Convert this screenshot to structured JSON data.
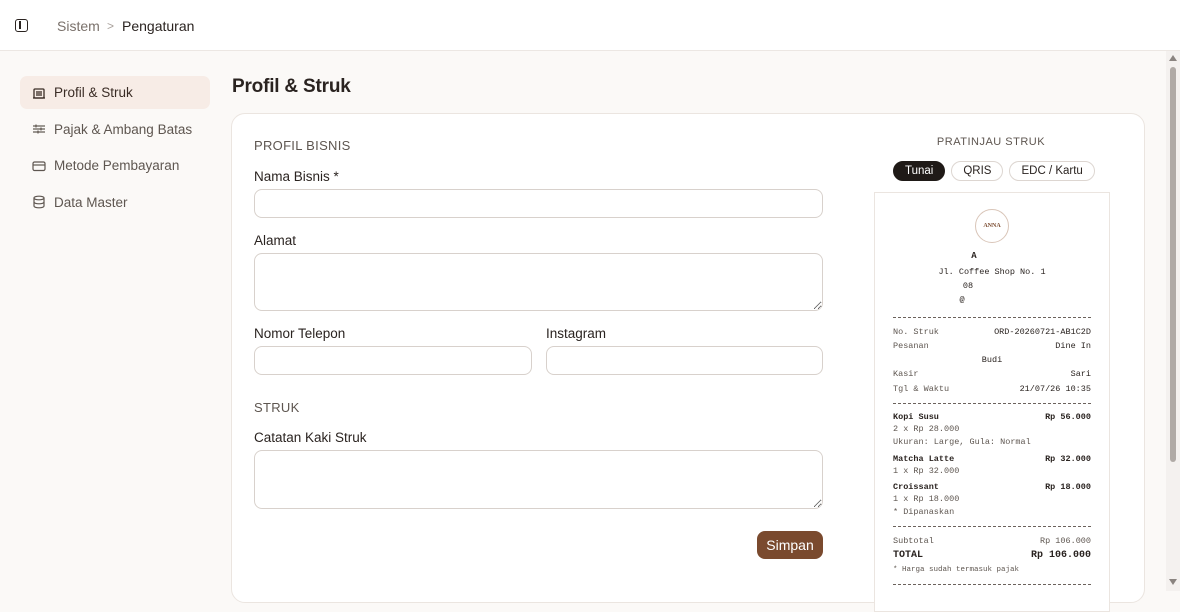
{
  "breadcrumb": {
    "parent": "Sistem",
    "separator": ">",
    "current": "Pengaturan"
  },
  "sidebar": {
    "items": [
      {
        "label": "Profil & Struk",
        "icon": "building-icon",
        "active": true
      },
      {
        "label": "Pajak & Ambang Batas",
        "icon": "sliders-icon",
        "active": false
      },
      {
        "label": "Metode Pembayaran",
        "icon": "credit-card-icon",
        "active": false
      },
      {
        "label": "Data Master",
        "icon": "database-icon",
        "active": false
      }
    ]
  },
  "page": {
    "title": "Profil & Struk"
  },
  "form": {
    "profile_section": "PROFIL BISNIS",
    "business_name_label": "Nama Bisnis *",
    "business_name_value": "",
    "address_label": "Alamat",
    "address_value": "",
    "phone_label": "Nomor Telepon",
    "phone_value": "",
    "instagram_label": "Instagram",
    "instagram_value": "",
    "receipt_section": "STRUK",
    "footer_note_label": "Catatan Kaki Struk",
    "footer_note_value": "",
    "save_label": "Simpan"
  },
  "preview": {
    "title": "PRATINJAU STRUK",
    "tabs": [
      {
        "label": "Tunai",
        "active": true
      },
      {
        "label": "QRIS",
        "active": false
      },
      {
        "label": "EDC / Kartu",
        "active": false
      }
    ],
    "receipt": {
      "logo_text": "ANNA",
      "business_initial": "A",
      "address": "Jl. Coffee Shop No. 1",
      "phone_line": "08",
      "ig_line": "@",
      "info": [
        {
          "label": "No. Struk",
          "value": "ORD-20260721-AB1C2D"
        },
        {
          "label": "Pesanan",
          "value": "Dine In"
        },
        {
          "label": "",
          "value": "Budi"
        },
        {
          "label": "Kasir",
          "value": "Sari"
        },
        {
          "label": "Tgl & Waktu",
          "value": "21/07/26 10:35"
        }
      ],
      "items": [
        {
          "name": "Kopi Susu",
          "price": "Rp 56.000",
          "detail": "2 x Rp 28.000",
          "note": "Ukuran: Large, Gula: Normal"
        },
        {
          "name": "Matcha Latte",
          "price": "Rp 32.000",
          "detail": "1 x Rp 32.000",
          "note": ""
        },
        {
          "name": "Croissant",
          "price": "Rp 18.000",
          "detail": "1 x Rp 18.000",
          "note": "* Dipanaskan"
        }
      ],
      "subtotal_label": "Subtotal",
      "subtotal_value": "Rp 106.000",
      "total_label": "TOTAL",
      "total_value": "Rp 106.000",
      "tax_note": "* Harga sudah termasuk pajak"
    }
  }
}
